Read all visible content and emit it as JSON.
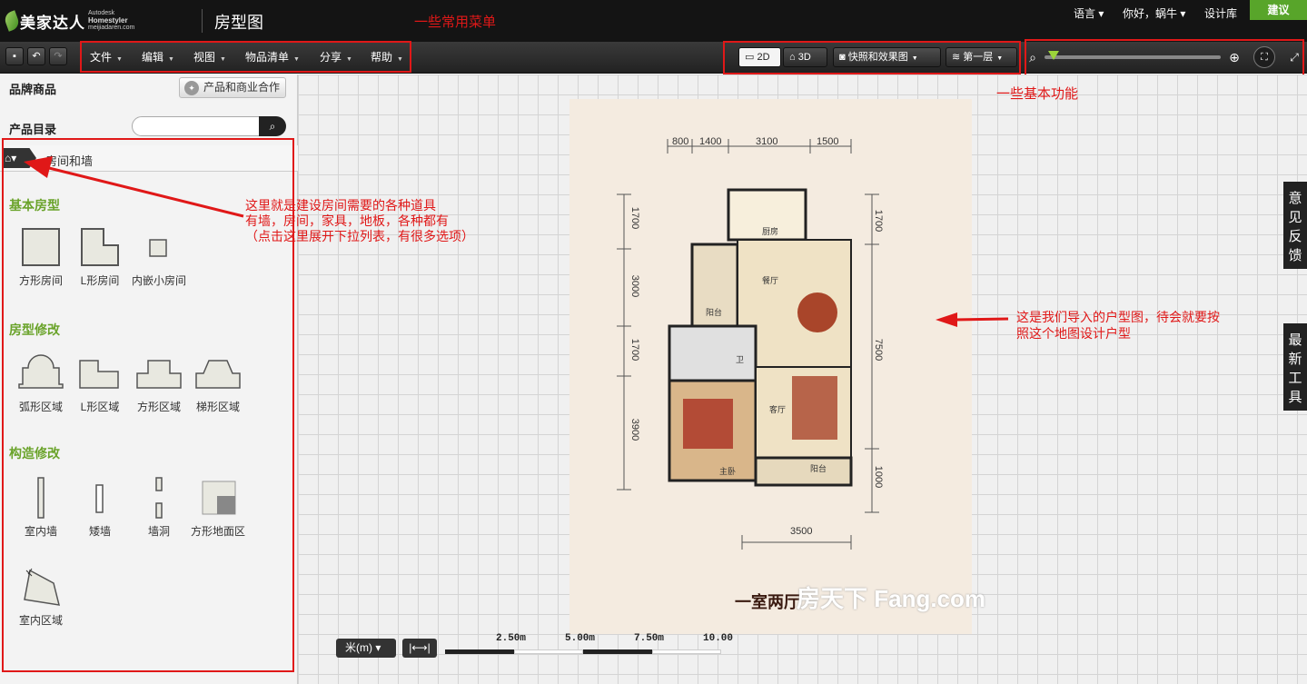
{
  "app": {
    "logo_text": "美家达人",
    "logo_sub1": "Autodesk",
    "logo_sub2": "Homestyler",
    "logo_sub3": "meijiadaren.com",
    "page_title": "房型图"
  },
  "topnav": {
    "language": "语言 ▾",
    "greeting": "你好，蜗牛 ▾",
    "design_library": "设计库",
    "suggest": "建议"
  },
  "toolbar": {
    "menus": [
      "文件",
      "编辑",
      "视图",
      "物品清单",
      "分享",
      "帮助"
    ],
    "view_2d": "2D",
    "view_3d": "3D",
    "snapshot": "快照和效果图",
    "floor": "第一层",
    "zoom_level": 0.05
  },
  "annotations": {
    "menus": "一些常用菜单",
    "basic_functions": "一些基本功能",
    "tools_line1": "这里就是建设房间需要的各种道具",
    "tools_line2": "有墙，房间，家具，地板，各种都有",
    "tools_line3": "（点击这里展开下拉列表，有很多选项）",
    "import_line1": "这是我们导入的户型图，待会就要按",
    "import_line2": "照这个地图设计户型"
  },
  "left_panel": {
    "brand_title": "品牌商品",
    "coop_button": "产品和商业合作",
    "catalog_title": "产品目录",
    "search_placeholder": "",
    "breadcrumb": "房间和墙",
    "sections": [
      {
        "title": "基本房型",
        "items": [
          "方形房间",
          "L形房间",
          "内嵌小房间"
        ]
      },
      {
        "title": "房型修改",
        "items": [
          "弧形区域",
          "L形区域",
          "方形区域",
          "梯形区域"
        ]
      },
      {
        "title": "构造修改",
        "items": [
          "室内墙",
          "矮墙",
          "墙洞",
          "方形地面区"
        ]
      },
      {
        "title": "",
        "items": [
          "室内区域"
        ]
      }
    ]
  },
  "floorplan": {
    "top_dims": [
      "800",
      "1400",
      "3100",
      "1500"
    ],
    "left_dims": [
      "1700",
      "3000",
      "1700",
      "3900"
    ],
    "right_dims": [
      "1700",
      "7500",
      "1000"
    ],
    "bottom_dim": "3500",
    "rooms": [
      "厨房",
      "餐厅",
      "阳台",
      "卫",
      "客厅",
      "主卧",
      "阳台"
    ],
    "caption": "一室两厅",
    "watermark": "房天下 Fang.com"
  },
  "side_tabs": {
    "feedback": "意见反馈",
    "new_tools": "最新工具"
  },
  "scale": {
    "unit": "米(m)",
    "measure": "|⟷|",
    "labels": [
      "2.50m",
      "5.00m",
      "7.50m",
      "10.00"
    ]
  }
}
